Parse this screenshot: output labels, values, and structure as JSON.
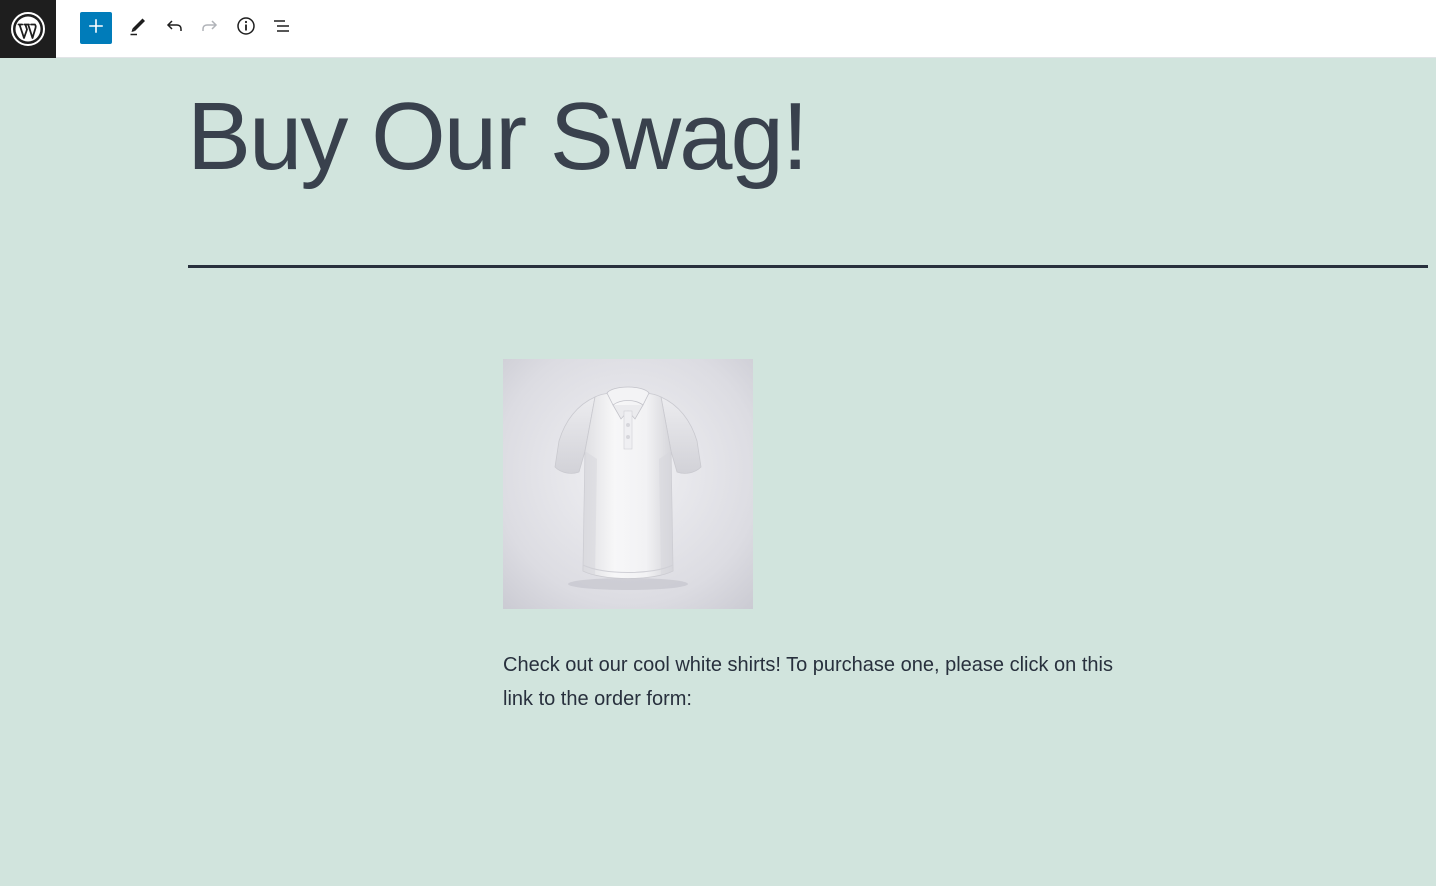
{
  "toolbar": {
    "logo_icon": "wordpress-logo-icon",
    "add_block_icon": "plus-icon",
    "tools_icon": "pencil-icon",
    "undo_icon": "undo-icon",
    "redo_icon": "redo-icon",
    "details_icon": "info-icon",
    "list_view_icon": "list-view-icon"
  },
  "content": {
    "title": "Buy Our Swag!",
    "image_subject": "white-polo-shirt",
    "paragraph": "Check out our cool white shirts!  To purchase one, please click on this link to the order form:"
  },
  "colors": {
    "background": "#d1e4dd",
    "accent": "#007cba",
    "logo_bg": "#1e1e1e",
    "title": "#39414d",
    "text": "#28303d"
  }
}
